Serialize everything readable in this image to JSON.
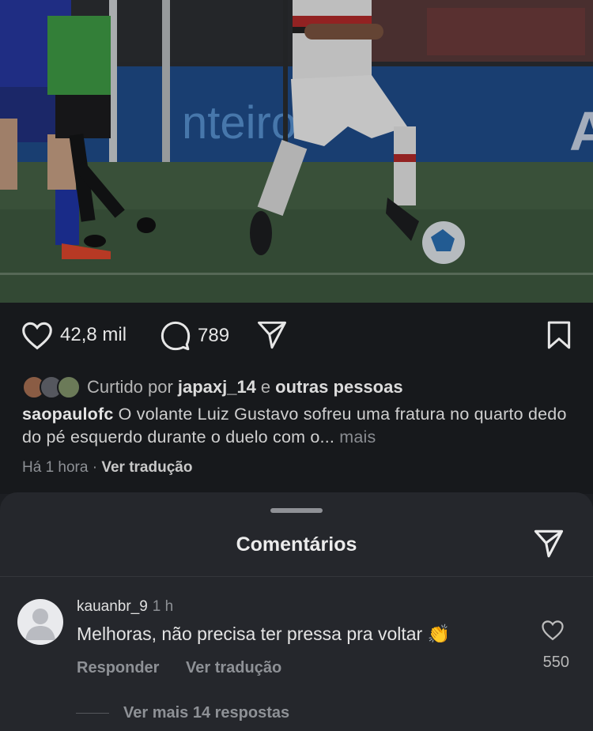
{
  "post": {
    "likes": "42,8 mil",
    "comments": "789",
    "liked_by_prefix": "Curtido por",
    "liked_by_user": "japaxj_14",
    "liked_by_and": "e",
    "liked_by_others": "outras pessoas",
    "caption_user": "saopaulofc",
    "caption_text": " O volante Luiz Gustavo sofreu uma fratura no quarto dedo do pé esquerdo durante o duelo com o...",
    "caption_more": " mais",
    "time": "Há 1 hora",
    "separator": " · ",
    "translate": "Ver tradução"
  },
  "comments_sheet": {
    "title": "Comentários",
    "comment": {
      "user": "kauanbr_9",
      "time": "1 h",
      "text": "Melhoras, não precisa ter pressa pra voltar 👏",
      "reply": "Responder",
      "translate": "Ver tradução",
      "likes": "550"
    },
    "more_replies": "Ver mais 14 respostas"
  },
  "icons": {
    "like": "heart-icon",
    "comment": "comment-bubble-icon",
    "share": "paper-plane-icon",
    "save": "bookmark-icon"
  }
}
